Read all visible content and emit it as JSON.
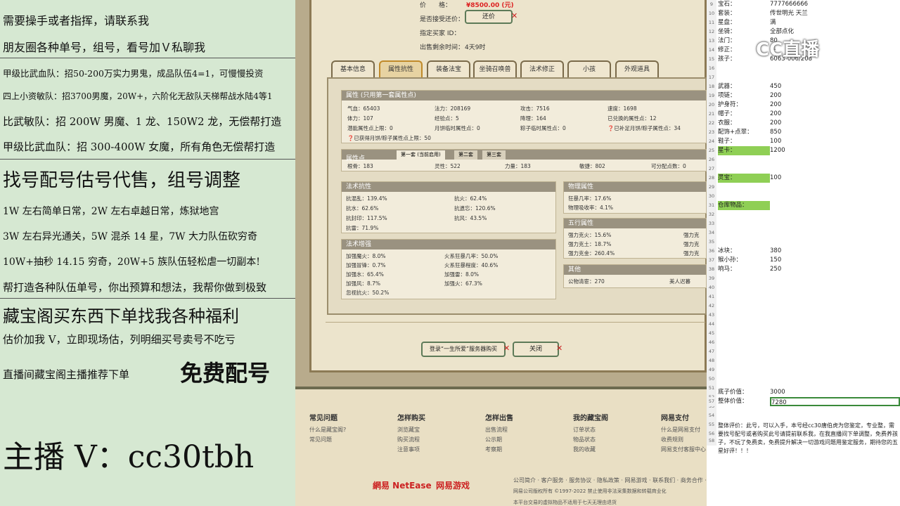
{
  "left_panel": {
    "lines": [
      "需要操手或者指挥，请联系我",
      "朋友圈各种单号，组号，看号加Ｖ私聊我",
      "甲级比武血队：招50-200万实力男鬼，成品队伍4=1，可慢慢投资",
      "四上小资敏队：招3700男魔，20W+，六阶化无敌队天梯帮战水陆4等1",
      "比武敏队：招 200W 男魔、1 龙、150W2 龙，无偿帮打造",
      "甲级比武血队：招 300-400W 女魔，所有角色无偿帮打造",
      "找号配号估号代售，组号调整",
      "1W 左右简单日常，2W 左右卓越日常，炼狱地宫",
      "3W 左右异光通关，5W 混杀 14 星，7W 大力队伍砍穷奇",
      "10W+抽秒 14.15 穷奇，20W+5 族队伍轻松虐一切副本!",
      "帮打造各种队伍单号，你出预算和想法，我帮你做到极致",
      "藏宝阁买东西下单找我各种福利",
      "估价加我 V，立即现场估，列明细买号卖号不吃亏",
      "直播间藏宝阁主播推荐下单",
      "免费配号",
      "主播 V：cc30tbh"
    ]
  },
  "game": {
    "price_label": "价　　格：",
    "price_value": "¥8500.00 (元)",
    "bargain_label": "是否接受还价：",
    "bargain_btn": "还价",
    "buyer_label": "指定买家 ID：",
    "time_label": "出售剩余时间：",
    "time_value": "4天9时",
    "tabs": [
      "基本信息",
      "属性抗性",
      "装备法宝",
      "坐骑召唤兽",
      "法术修正",
      "小孩",
      "外观道具"
    ],
    "attr": {
      "header": "属性 (只用第一套属性点)",
      "r1": [
        "气血：65403",
        "法力：208169",
        "攻击：7516",
        "速度：1698"
      ],
      "r2": [
        "体力：107",
        "经验点：5",
        "降理：164",
        "已兑换的属性点：12"
      ],
      "r3": [
        "潜能属性点上限：0",
        "月饼临时属性点：0",
        "粽子临时属性点：0",
        "已补足月饼/粽子属性点：34"
      ],
      "r4": "已获得月饼/粽子属性点上限：50"
    },
    "points": {
      "header": "属性点",
      "tabs": [
        "第一套 (当前启用)",
        "第二套",
        "第三套"
      ],
      "row": [
        "根骨：183",
        "灵性：522",
        "力量：183",
        "敏捷：802",
        "可分配点数：0"
      ]
    },
    "resist": {
      "header": "法术抗性",
      "rows": [
        [
          "抗混乱：139.4%",
          "抗火：62.4%"
        ],
        [
          "抗水：62.6%",
          "抗遗忘：120.6%"
        ],
        [
          "抗封印：117.5%",
          "抗风：43.5%"
        ],
        [
          "抗雷：71.9%",
          ""
        ]
      ]
    },
    "enhance": {
      "header": "法术增强",
      "rows": [
        [
          "加强魔火：8.0%",
          "火系狂暴几率：50.0%"
        ],
        [
          "加强冒锋：0.7%",
          "火系狂暴程度：40.6%"
        ],
        [
          "加强水：65.4%",
          "加强雷：8.0%"
        ],
        [
          "加强风：8.7%",
          "加强火：67.3%"
        ],
        [
          "忽视抗火：50.2%",
          ""
        ]
      ]
    },
    "physical": {
      "header": "物理属性",
      "rows": [
        "狂暴几率：17.6%",
        "物理吸收率：4.1%"
      ]
    },
    "five": {
      "header": "五行属性",
      "rows": [
        "强力克火：15.6%",
        "强力克土：18.7%",
        "强力克金：260.4%"
      ],
      "right": [
        "强力克",
        "强力克",
        "强力克"
      ]
    },
    "other": {
      "header": "其他",
      "row": "公物清宦：270",
      "right": "美人迟暮"
    },
    "login_btn": "登录“一生所爱”服务器购买",
    "close_btn": "关闭"
  },
  "footer": {
    "heads": [
      "常见问题",
      "怎样购买",
      "怎样出售",
      "我的藏宝阁",
      "网易支付"
    ],
    "cols": [
      [
        "什么是藏宝阁?",
        "常见问题"
      ],
      [
        "浏览藏宝",
        "购买流程",
        "注意事项"
      ],
      [
        "出售流程",
        "公示期",
        "考察期"
      ],
      [
        "订单状态",
        "物品状态",
        "我的收藏"
      ],
      [
        "什么是网易支付",
        "收费规则",
        "网易支付客服中心"
      ]
    ],
    "links": "公司简介 · 客户服务 · 服务协议 · 隐私政策 · 网易游戏 · 联系我们 · 商务合作 · 加入",
    "copy": "网易公司版权所有 ©1997-2022 禁止使用非法采集数据和转载商业化",
    "notice": "本平台交易的虚拟物品不适用于七天无理由退货",
    "brand1": "網易 NetEase",
    "brand2": "网易游戏"
  },
  "sheet": {
    "rows": [
      {
        "n": "9",
        "a": "宝石：",
        "b": "7777666666"
      },
      {
        "n": "10",
        "a": "套装：",
        "b": "传世明光 天兰"
      },
      {
        "n": "11",
        "a": "星盘：",
        "b": "满"
      },
      {
        "n": "12",
        "a": "坐骑：",
        "b": "全部点化"
      },
      {
        "n": "13",
        "a": "法门：",
        "b": "80"
      },
      {
        "n": "14",
        "a": "修正：",
        "b": "手"
      },
      {
        "n": "15",
        "a": "孩子：",
        "b": "6063-006/208"
      },
      {
        "n": "16",
        "a": "",
        "b": ""
      },
      {
        "n": "17",
        "a": "",
        "b": ""
      },
      {
        "n": "18",
        "a": "武器：",
        "b": "450"
      },
      {
        "n": "19",
        "a": "项链：",
        "b": "200"
      },
      {
        "n": "20",
        "a": "护身符：",
        "b": "200"
      },
      {
        "n": "21",
        "a": "帽子：",
        "b": "200"
      },
      {
        "n": "22",
        "a": "衣服：",
        "b": "200"
      },
      {
        "n": "23",
        "a": "配饰+点翠：",
        "b": "850"
      },
      {
        "n": "24",
        "a": "鞋子：",
        "b": "100"
      },
      {
        "n": "25",
        "a": "星卡：",
        "b": "1200"
      },
      {
        "n": "26",
        "a": "",
        "b": ""
      },
      {
        "n": "27",
        "a": "",
        "b": ""
      },
      {
        "n": "28",
        "a": "灵宝：",
        "b": "100"
      },
      {
        "n": "29",
        "a": "",
        "b": ""
      },
      {
        "n": "30",
        "a": "",
        "b": ""
      },
      {
        "n": "31",
        "a": "仓库物品：",
        "b": ""
      },
      {
        "n": "32",
        "a": "",
        "b": ""
      },
      {
        "n": "33",
        "a": "",
        "b": ""
      },
      {
        "n": "34",
        "a": "",
        "b": ""
      },
      {
        "n": "35",
        "a": "",
        "b": ""
      },
      {
        "n": "36",
        "a": "冰块：",
        "b": "380"
      },
      {
        "n": "37",
        "a": "猴小孙：",
        "b": "150"
      },
      {
        "n": "38",
        "a": "响马：",
        "b": "250"
      }
    ],
    "tail_nums": [
      "39",
      "40",
      "41",
      "42",
      "43",
      "44",
      "45",
      "46",
      "47",
      "48",
      "49",
      "50",
      "51",
      "52",
      "53",
      "54",
      "55",
      "56"
    ],
    "kid_label": "底子价值：",
    "kid_value": "3000",
    "total_label": "整体价值：",
    "total_value": "7280",
    "comment": "整体评价：此号，可以入手，本号经cc30唐伯虎为您鉴定，专业整，需要找号配号或者购买此号请提前联系我，在我直播间下单调整，免费养孩子，不玩了免费卖，免费提升解决一切游戏问题用鉴定服务，期待您的五星好评！！！",
    "row_57": "57",
    "row_58": "58",
    "cc_logo": "CC直播"
  },
  "colors": {
    "sheet_highlight": "#8fcf55",
    "price": "#d22"
  }
}
